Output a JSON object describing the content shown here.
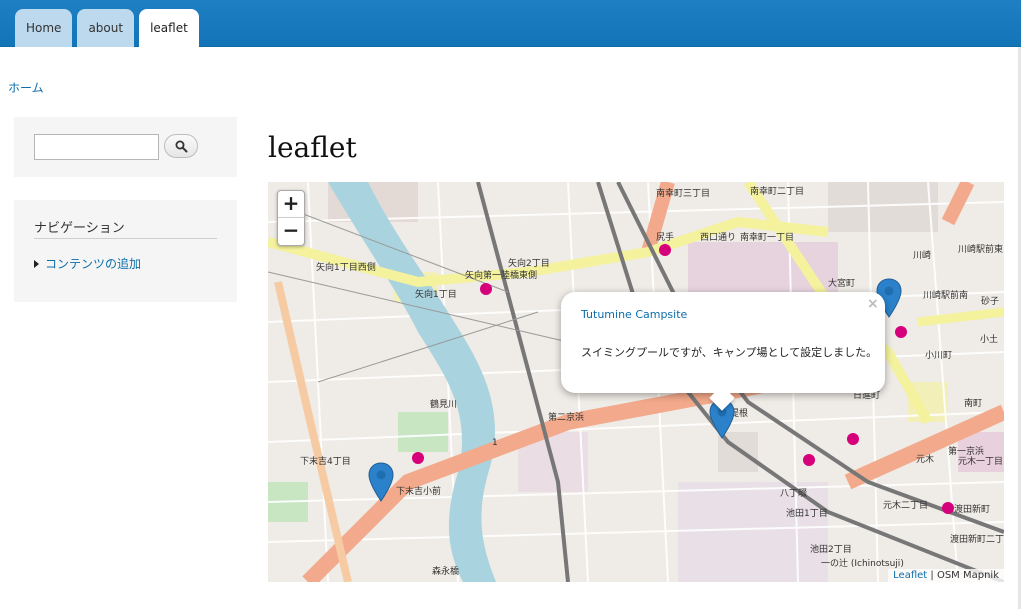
{
  "tabs": [
    {
      "label": "Home"
    },
    {
      "label": "about"
    },
    {
      "label": "leaflet"
    }
  ],
  "breadcrumb": {
    "home": "ホーム"
  },
  "sidebar": {
    "search": {
      "value": "",
      "button_icon": "search-icon"
    },
    "navigation": {
      "title": "ナビゲーション",
      "items": [
        {
          "label": "コンテンツの追加"
        }
      ]
    }
  },
  "page": {
    "title": "leaflet"
  },
  "map": {
    "zoom_in": "+",
    "zoom_out": "−",
    "popup": {
      "title": "Tutumine Campsite",
      "text": "スイミングプールですが、キャンプ場として設定しました。",
      "close": "×"
    },
    "attribution": {
      "leaflet": "Leaflet",
      "separator": " | ",
      "tiles": "OSM Mapnik"
    },
    "labels": [
      {
        "text": "南幸町三丁目"
      },
      {
        "text": "南幸町二丁目"
      },
      {
        "text": "西口通り"
      },
      {
        "text": "南幸町一丁目"
      },
      {
        "text": "尻手"
      },
      {
        "text": "矢向1丁目西側"
      },
      {
        "text": "矢向2丁目"
      },
      {
        "text": "矢向第一陸橋東側"
      },
      {
        "text": "矢向1丁目"
      },
      {
        "text": "川崎"
      },
      {
        "text": "川崎駅前東"
      },
      {
        "text": "大宮町"
      },
      {
        "text": "川崎駅前南"
      },
      {
        "text": "砂子"
      },
      {
        "text": "小土"
      },
      {
        "text": "小川町"
      },
      {
        "text": "堤根"
      },
      {
        "text": "第一京浜"
      },
      {
        "text": "第二京浜"
      },
      {
        "text": "南町"
      },
      {
        "text": "下末吉4丁目"
      },
      {
        "text": "下末吉小前"
      },
      {
        "text": "元木"
      },
      {
        "text": "元木一丁目"
      },
      {
        "text": "元木二丁目"
      },
      {
        "text": "八丁畷"
      },
      {
        "text": "池田1丁目"
      },
      {
        "text": "渡田新町"
      },
      {
        "text": "池田2丁目"
      },
      {
        "text": "渡田新町二丁目"
      },
      {
        "text": "一の辻 (Ichinotsuji)"
      },
      {
        "text": "森永橋"
      },
      {
        "text": "鶴見川"
      },
      {
        "text": "1"
      },
      {
        "text": "日進町"
      }
    ],
    "markers": [
      {
        "name": "marker-1"
      },
      {
        "name": "marker-2"
      },
      {
        "name": "marker-3"
      }
    ]
  }
}
